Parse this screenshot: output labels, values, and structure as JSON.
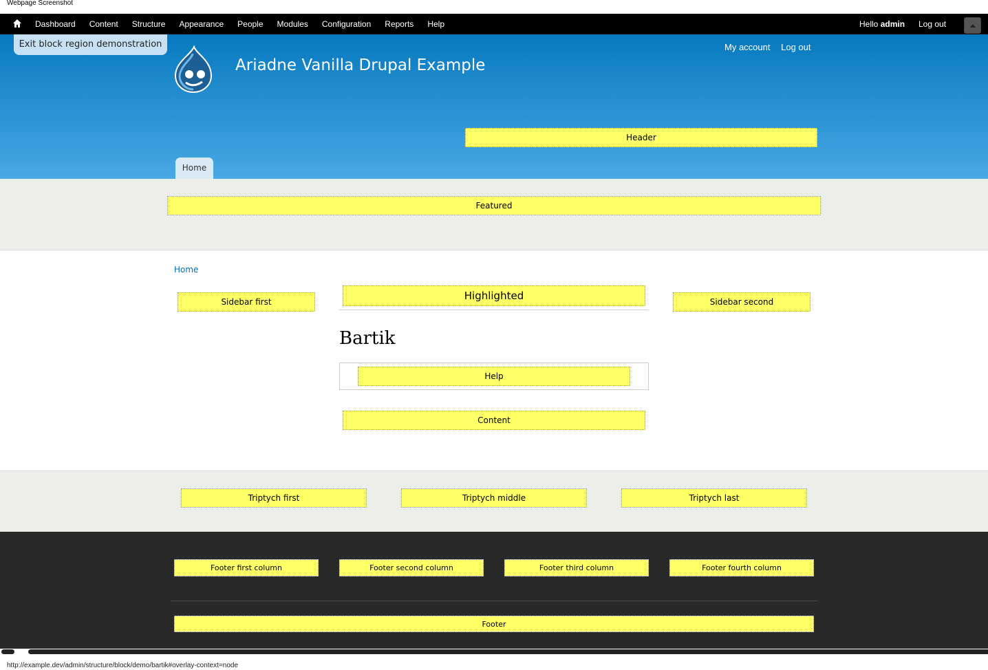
{
  "caption": "Webpage Screenshot",
  "toolbar": {
    "menu": [
      "Dashboard",
      "Content",
      "Structure",
      "Appearance",
      "People",
      "Modules",
      "Configuration",
      "Reports",
      "Help"
    ],
    "greeting_prefix": "Hello ",
    "username": "admin",
    "logout": "Log out"
  },
  "exit_demo": "Exit block region demonstration",
  "site": {
    "name": "Ariadne Vanilla Drupal Example",
    "secondary_menu": [
      "My account",
      "Log out"
    ],
    "home_tab": "Home"
  },
  "regions": {
    "header": "Header",
    "featured": "Featured",
    "sidebar_first": "Sidebar first",
    "highlighted": "Highlighted",
    "sidebar_second": "Sidebar second",
    "help": "Help",
    "content": "Content",
    "triptych_first": "Triptych first",
    "triptych_middle": "Triptych middle",
    "triptych_last": "Triptych last",
    "footer_first": "Footer first column",
    "footer_second": "Footer second column",
    "footer_third": "Footer third column",
    "footer_fourth": "Footer fourth column",
    "footer": "Footer"
  },
  "breadcrumb": "Home",
  "page_title": "Bartik",
  "status_url": "http://example.dev/admin/structure/block/demo/bartik#overlay-context=node",
  "colors": {
    "toolbar_bg": "#000000",
    "header_top": "#0779bf",
    "header_bottom": "#48a9e4",
    "region_highlight": "#ffff66",
    "band_gray": "#eceeea",
    "footer_bg": "#292929",
    "link": "#0071b3"
  }
}
